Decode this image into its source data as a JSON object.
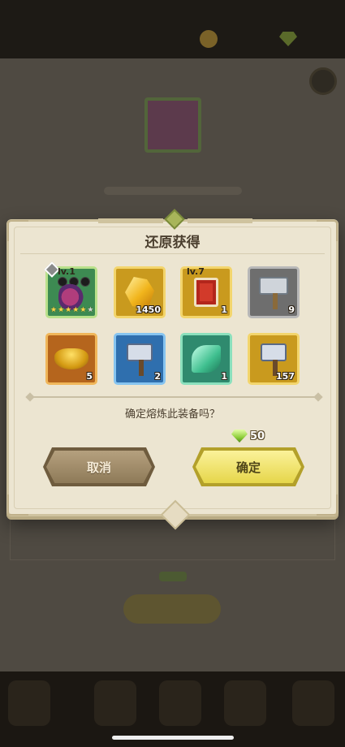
{
  "dialog": {
    "title": "还原获得",
    "confirm_text": "确定熔炼此装备吗？",
    "cost": "50",
    "cost_icon": "gem-icon",
    "cancel_label": "取消",
    "ok_label": "确定"
  },
  "items": [
    {
      "name": "bow-equipment",
      "level": "lv.1",
      "count": "",
      "rarity": "green",
      "stars": 6
    },
    {
      "name": "gold-ore",
      "level": "",
      "count": "1450",
      "rarity": "gold"
    },
    {
      "name": "red-book",
      "level": "lv.7",
      "count": "1",
      "rarity": "gold"
    },
    {
      "name": "iron-hammer",
      "level": "",
      "count": "9",
      "rarity": "gray"
    },
    {
      "name": "gold-bowl",
      "level": "",
      "count": "5",
      "rarity": "orange"
    },
    {
      "name": "blue-hammer",
      "level": "",
      "count": "2",
      "rarity": "blue"
    },
    {
      "name": "green-leaf",
      "level": "",
      "count": "1",
      "rarity": "teal"
    },
    {
      "name": "gold-hammer",
      "level": "",
      "count": "157",
      "rarity": "gold"
    }
  ],
  "colors": {
    "dialog_bg": "#ece5d1",
    "cancel_button": "#a08b68",
    "ok_button": "#f0e46a"
  }
}
